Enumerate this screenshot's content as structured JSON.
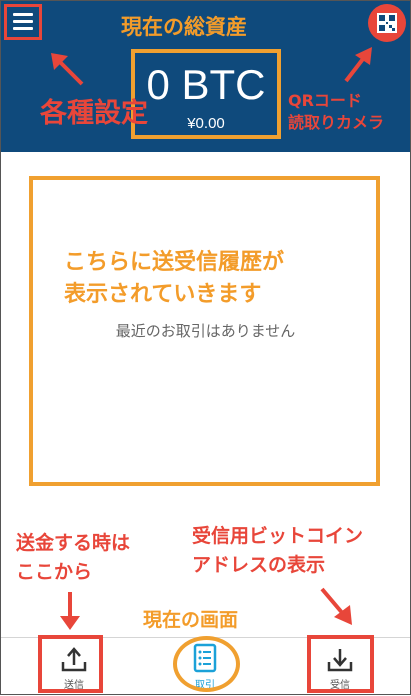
{
  "header": {
    "total_assets_label": "現在の総資産",
    "btc_balance": "0 BTC",
    "jpy_balance": "¥0.00",
    "menu_note": "各種設定",
    "qr_note_line1": "QRコード",
    "qr_note_line2": "読取りカメラ"
  },
  "main": {
    "history_note_line1": "こちらに送受信履歴が",
    "history_note_line2": "表示されていきます",
    "empty_message": "最近のお取引はありません"
  },
  "notes": {
    "send_line1": "送金する時は",
    "send_line2": "ここから",
    "receive_line1": "受信用ビットコイン",
    "receive_line2": "アドレスの表示",
    "current_screen": "現在の画面"
  },
  "tabs": [
    {
      "label": "送信",
      "icon": "upload-icon"
    },
    {
      "label": "取引",
      "icon": "list-icon",
      "active": true
    },
    {
      "label": "受信",
      "icon": "download-icon"
    }
  ],
  "colors": {
    "header_bg": "#0f4a7c",
    "annotation_red": "#e8463a",
    "annotation_orange": "#f39c2a",
    "active_tab": "#1ba1d8"
  }
}
